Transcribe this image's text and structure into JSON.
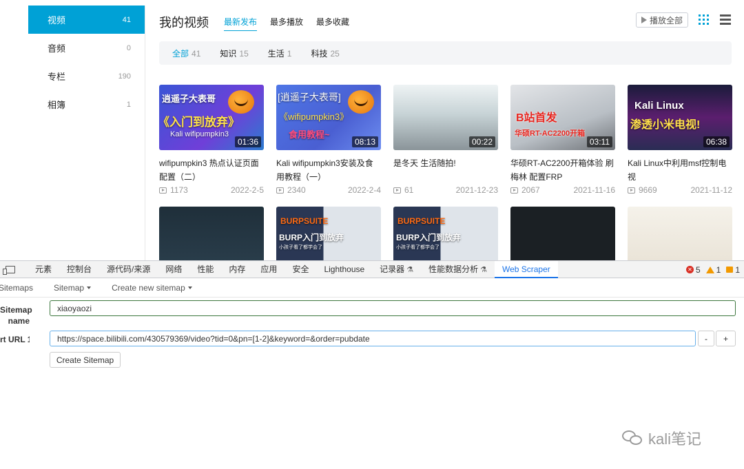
{
  "sidebar": {
    "items": [
      {
        "label": "视频",
        "count": "41"
      },
      {
        "label": "音频",
        "count": "0"
      },
      {
        "label": "专栏",
        "count": "190"
      },
      {
        "label": "相簿",
        "count": "1"
      }
    ]
  },
  "header": {
    "title": "我的视频",
    "sort_tabs": [
      "最新发布",
      "最多播放",
      "最多收藏"
    ],
    "play_all": "播放全部"
  },
  "filters": [
    {
      "label": "全部",
      "count": "41"
    },
    {
      "label": "知识",
      "count": "15"
    },
    {
      "label": "生活",
      "count": "1"
    },
    {
      "label": "科技",
      "count": "25"
    }
  ],
  "videos": [
    {
      "title": "wifipumpkin3 热点认证页面配置（二）",
      "duration": "01:36",
      "plays": "1173",
      "date": "2022-2-5",
      "thumb_text": [
        "逍遥子大表哥",
        "《入门到放弃》",
        "Kali wifipumpkin3"
      ]
    },
    {
      "title": "Kali wifipumpkin3安装及食用教程（一）",
      "duration": "08:13",
      "plays": "2340",
      "date": "2022-2-4",
      "thumb_text": [
        "[逍遥子大表哥]",
        "《wifipumpkin3》",
        "食用教程~"
      ]
    },
    {
      "title": "是冬天 生活随拍!",
      "duration": "00:22",
      "plays": "61",
      "date": "2021-12-23",
      "thumb_text": []
    },
    {
      "title": "华硕RT-AC2200开箱体验 刷梅林 配置FRP",
      "duration": "03:11",
      "plays": "2067",
      "date": "2021-11-16",
      "thumb_text": [
        "B站首发",
        "华硕RT-AC2200开箱"
      ]
    },
    {
      "title": "Kali Linux中利用msf控制电视",
      "duration": "06:38",
      "plays": "9669",
      "date": "2021-11-12",
      "thumb_text": [
        "Kali Linux",
        "渗透小米电视!"
      ]
    }
  ],
  "videos_row2": [
    {
      "thumb_text": []
    },
    {
      "thumb_text": [
        "BURPSUITE",
        "BURP入门到放弃",
        "小孩子看了都学会了"
      ]
    },
    {
      "thumb_text": [
        "BURPSUITE",
        "BURP入门到放弃",
        "小孩子看了都学会了"
      ]
    },
    {
      "thumb_text": []
    },
    {
      "thumb_text": []
    }
  ],
  "devtools": {
    "tabs": [
      "元素",
      "控制台",
      "源代码/来源",
      "网络",
      "性能",
      "内存",
      "应用",
      "安全",
      "Lighthouse",
      "记录器",
      "性能数据分析",
      "Web Scraper"
    ],
    "active_tab": "Web Scraper",
    "errors": "5",
    "warnings": "1",
    "infos": "1"
  },
  "scraper": {
    "nav": [
      "Sitemaps",
      "Sitemap",
      "Create new sitemap"
    ],
    "sitemap_name_label_1": "Sitemap",
    "sitemap_name_label_2": "name",
    "sitemap_name_value": "xiaoyaozi",
    "start_url_label": "rt URL 1",
    "start_url_value": "https://space.bilibili.com/430579369/video?tid=0&pn=[1-2]&keyword=&order=pubdate",
    "minus_label": "-",
    "plus_label": "+",
    "create_button": "Create Sitemap"
  },
  "watermark": "kali笔记",
  "colors": {
    "accent": "#00a1d6",
    "devtools_accent": "#1a73e8"
  }
}
